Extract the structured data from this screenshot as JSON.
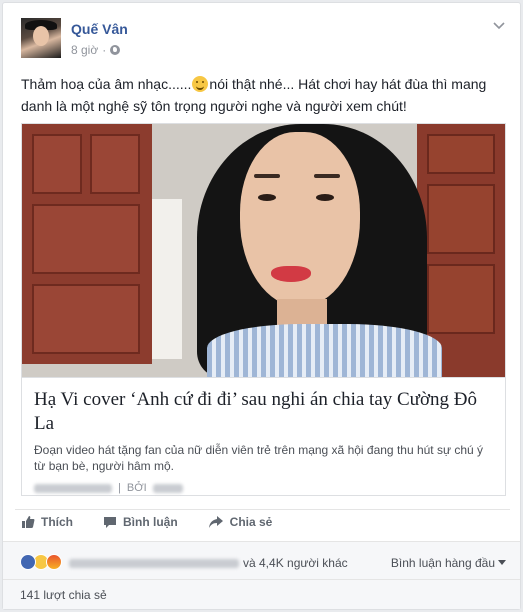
{
  "post": {
    "author": "Quế Vân",
    "time": "8 giờ",
    "separator": "·",
    "privacy_icon": "globe-icon",
    "text_before_emoji": "Thảm hoạ của âm nhạc......",
    "text_after_emoji": "nói thật nhé... Hát chơi hay hát đùa thì mang danh là một nghệ sỹ tôn trọng người nghe và người xem chút!"
  },
  "link": {
    "title": "Hạ Vi cover ‘Anh cứ đi đi’ sau nghi án chia tay Cường Đô La",
    "description": "Đoạn video hát tặng fan của nữ diễn viên trẻ trên mạng xã hội đang thu hút sự chú ý từ bạn bè, người hâm mộ.",
    "source_separator": "|",
    "by_label": "BỞI"
  },
  "actions": {
    "like": "Thích",
    "comment": "Bình luận",
    "share": "Chia sẻ"
  },
  "reactions": {
    "icons": [
      "like-reaction-icon",
      "haha-reaction-icon",
      "angry-reaction-icon"
    ],
    "others_text": "và 4,4K người khác",
    "top_comments": "Bình luận hàng đầu"
  },
  "shares": {
    "count_text": "141 lượt chia sẻ"
  },
  "colors": {
    "link_blue": "#365899",
    "meta_gray": "#90949c",
    "lip_red": "#d23a44"
  }
}
